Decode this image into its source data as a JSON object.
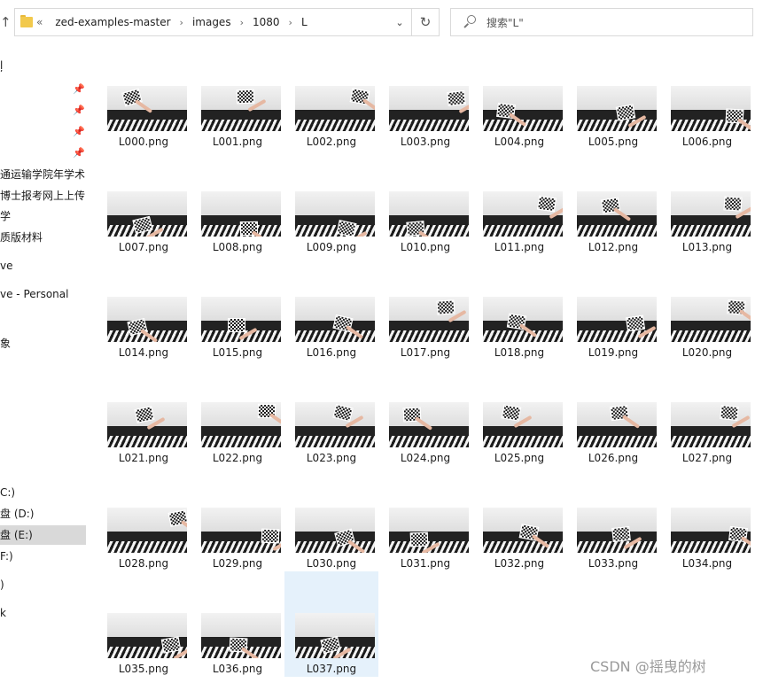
{
  "address_bar": {
    "overflow": "«",
    "crumbs": [
      "zed-examples-master",
      "images",
      "1080",
      "L"
    ],
    "separator": "›"
  },
  "search": {
    "placeholder": "搜索\"L\""
  },
  "sidebar": {
    "items": [
      {
        "label": "ļ",
        "selected": false
      },
      {
        "label": "",
        "selected": false,
        "pinned": true
      },
      {
        "label": "",
        "selected": false,
        "pinned": true
      },
      {
        "label": "",
        "selected": false,
        "pinned": true
      },
      {
        "label": "",
        "selected": false,
        "pinned": true
      },
      {
        "label": "通运输学院年学术",
        "selected": false
      },
      {
        "label": "博士报考网上上传",
        "selected": false
      },
      {
        "label": "学",
        "selected": false
      },
      {
        "label": "质版材料",
        "selected": false
      },
      {
        "label": "ve",
        "selected": false
      },
      {
        "label": "ve - Personal",
        "selected": false
      },
      {
        "label": "象",
        "selected": false
      },
      {
        "label": "C:)",
        "selected": false
      },
      {
        "label": "盘 (D:)",
        "selected": false
      },
      {
        "label": "盘 (E:)",
        "selected": true
      },
      {
        "label": "F:)",
        "selected": false
      },
      {
        "label": ")",
        "selected": false
      },
      {
        "label": "k",
        "selected": false
      }
    ]
  },
  "files": [
    "L000.png",
    "L001.png",
    "L002.png",
    "L003.png",
    "L004.png",
    "L005.png",
    "L006.png",
    "L007.png",
    "L008.png",
    "L009.png",
    "L010.png",
    "L011.png",
    "L012.png",
    "L013.png",
    "L014.png",
    "L015.png",
    "L016.png",
    "L017.png",
    "L018.png",
    "L019.png",
    "L020.png",
    "L021.png",
    "L022.png",
    "L023.png",
    "L024.png",
    "L025.png",
    "L026.png",
    "L027.png",
    "L028.png",
    "L029.png",
    "L030.png",
    "L031.png",
    "L032.png",
    "L033.png",
    "L034.png",
    "L035.png",
    "L036.png",
    "L037.png"
  ],
  "selected_file": "L037.png",
  "watermark": "CSDN @摇曳的树",
  "colors": {
    "selection": "#e5f1fb",
    "sidebar_selected": "#d9d9d9",
    "folder": "#f2c94c"
  }
}
